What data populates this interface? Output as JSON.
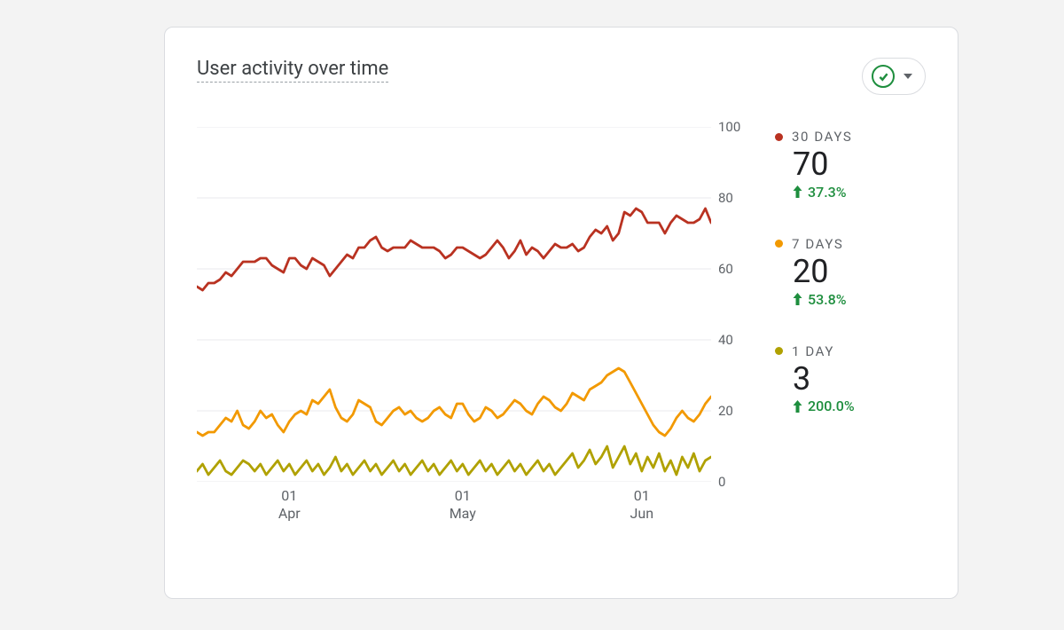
{
  "card": {
    "title": "User activity over time",
    "status_button": {
      "semantic": "confirmed-dropdown"
    }
  },
  "legend": [
    {
      "label": "30 DAYS",
      "value": "70",
      "delta": "37.3%",
      "color": "#b93221"
    },
    {
      "label": "7 DAYS",
      "value": "20",
      "delta": "53.8%",
      "color": "#f29900"
    },
    {
      "label": "1 DAY",
      "value": "3",
      "delta": "200.0%",
      "color": "#b0a100"
    }
  ],
  "chart_data": {
    "type": "line",
    "title": "User activity over time",
    "xlabel": "",
    "ylabel": "",
    "ylim": [
      0,
      100
    ],
    "y_ticks": [
      0,
      20,
      40,
      60,
      80,
      100
    ],
    "x_tick_labels": [
      "01\nApr",
      "01\nMay",
      "01\nJun"
    ],
    "x_tick_index_positions": [
      16,
      46,
      77
    ],
    "x": [
      0,
      1,
      2,
      3,
      4,
      5,
      6,
      7,
      8,
      9,
      10,
      11,
      12,
      13,
      14,
      15,
      16,
      17,
      18,
      19,
      20,
      21,
      22,
      23,
      24,
      25,
      26,
      27,
      28,
      29,
      30,
      31,
      32,
      33,
      34,
      35,
      36,
      37,
      38,
      39,
      40,
      41,
      42,
      43,
      44,
      45,
      46,
      47,
      48,
      49,
      50,
      51,
      52,
      53,
      54,
      55,
      56,
      57,
      58,
      59,
      60,
      61,
      62,
      63,
      64,
      65,
      66,
      67,
      68,
      69,
      70,
      71,
      72,
      73,
      74,
      75,
      76,
      77,
      78,
      79,
      80,
      81,
      82,
      83,
      84,
      85,
      86,
      87,
      88,
      89
    ],
    "series": [
      {
        "name": "30 DAYS",
        "color": "#b93221",
        "values": [
          55,
          54,
          56,
          56,
          57,
          59,
          58,
          60,
          62,
          62,
          62,
          63,
          63,
          61,
          60,
          59,
          63,
          63,
          61,
          60,
          63,
          62,
          61,
          58,
          60,
          62,
          64,
          63,
          66,
          66,
          68,
          69,
          66,
          65,
          66,
          66,
          66,
          68,
          67,
          66,
          66,
          66,
          65,
          63,
          64,
          66,
          66,
          65,
          64,
          63,
          64,
          66,
          68,
          66,
          63,
          65,
          68,
          64,
          66,
          65,
          63,
          65,
          67,
          66,
          66,
          67,
          65,
          66,
          69,
          71,
          70,
          72,
          68,
          70,
          76,
          75,
          77,
          76,
          73,
          73,
          73,
          70,
          73,
          75,
          74,
          73,
          73,
          74,
          77,
          73
        ]
      },
      {
        "name": "7 DAYS",
        "color": "#f29900",
        "values": [
          14,
          13,
          14,
          14,
          16,
          18,
          17,
          20,
          16,
          15,
          17,
          20,
          18,
          19,
          16,
          14,
          17,
          19,
          20,
          19,
          23,
          22,
          24,
          26,
          21,
          18,
          17,
          19,
          23,
          22,
          21,
          17,
          16,
          18,
          20,
          21,
          19,
          20,
          18,
          17,
          18,
          20,
          21,
          19,
          18,
          22,
          22,
          19,
          17,
          18,
          21,
          20,
          18,
          19,
          21,
          23,
          22,
          20,
          19,
          22,
          24,
          23,
          21,
          20,
          22,
          25,
          24,
          23,
          26,
          27,
          28,
          30,
          31,
          32,
          31,
          28,
          25,
          22,
          19,
          16,
          14,
          13,
          15,
          18,
          20,
          18,
          17,
          19,
          22,
          24
        ]
      },
      {
        "name": "1 DAY",
        "color": "#b0a100",
        "values": [
          3,
          5,
          2,
          4,
          6,
          3,
          2,
          4,
          6,
          5,
          3,
          5,
          2,
          4,
          6,
          3,
          5,
          2,
          4,
          6,
          3,
          5,
          2,
          4,
          7,
          3,
          5,
          2,
          4,
          6,
          3,
          5,
          2,
          4,
          6,
          3,
          5,
          2,
          4,
          6,
          3,
          5,
          2,
          4,
          6,
          3,
          5,
          2,
          4,
          6,
          3,
          5,
          2,
          4,
          6,
          3,
          5,
          2,
          4,
          6,
          3,
          5,
          2,
          4,
          6,
          8,
          4,
          6,
          9,
          5,
          7,
          10,
          4,
          7,
          10,
          5,
          8,
          3,
          7,
          4,
          8,
          3,
          6,
          2,
          7,
          4,
          8,
          3,
          6,
          7
        ]
      }
    ]
  }
}
